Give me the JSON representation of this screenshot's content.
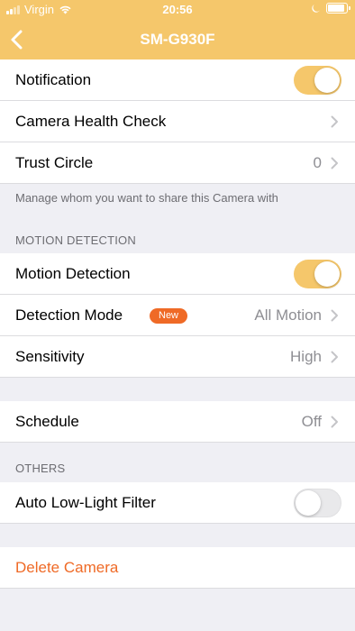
{
  "status_bar": {
    "carrier": "Virgin",
    "time": "20:56",
    "icons": [
      "signal-icon",
      "wifi-icon",
      "moon-icon",
      "battery-icon"
    ]
  },
  "nav": {
    "title": "SM-G930F",
    "back_icon": "chevron-left-icon"
  },
  "colors": {
    "header": "#f5c76b",
    "accent_orange": "#ef6a26",
    "toggle_on": "#f5c76b",
    "toggle_off": "#e9e9eb",
    "secondary_text": "#8e8e93"
  },
  "general": {
    "notification_label": "Notification",
    "notification_on": true,
    "health_check_label": "Camera Health Check",
    "trust_circle_label": "Trust Circle",
    "trust_circle_value": "0",
    "note": "Manage whom you want to share this Camera with"
  },
  "motion": {
    "section_title": "MOTION DETECTION",
    "motion_detection_label": "Motion Detection",
    "motion_detection_on": true,
    "detection_mode_label": "Detection Mode",
    "detection_mode_badge": "New",
    "detection_mode_value": "All Motion",
    "sensitivity_label": "Sensitivity",
    "sensitivity_value": "High"
  },
  "schedule": {
    "label": "Schedule",
    "value": "Off"
  },
  "others": {
    "section_title": "OTHERS",
    "low_light_label": "Auto Low-Light Filter",
    "low_light_on": false
  },
  "danger": {
    "delete_label": "Delete Camera"
  }
}
